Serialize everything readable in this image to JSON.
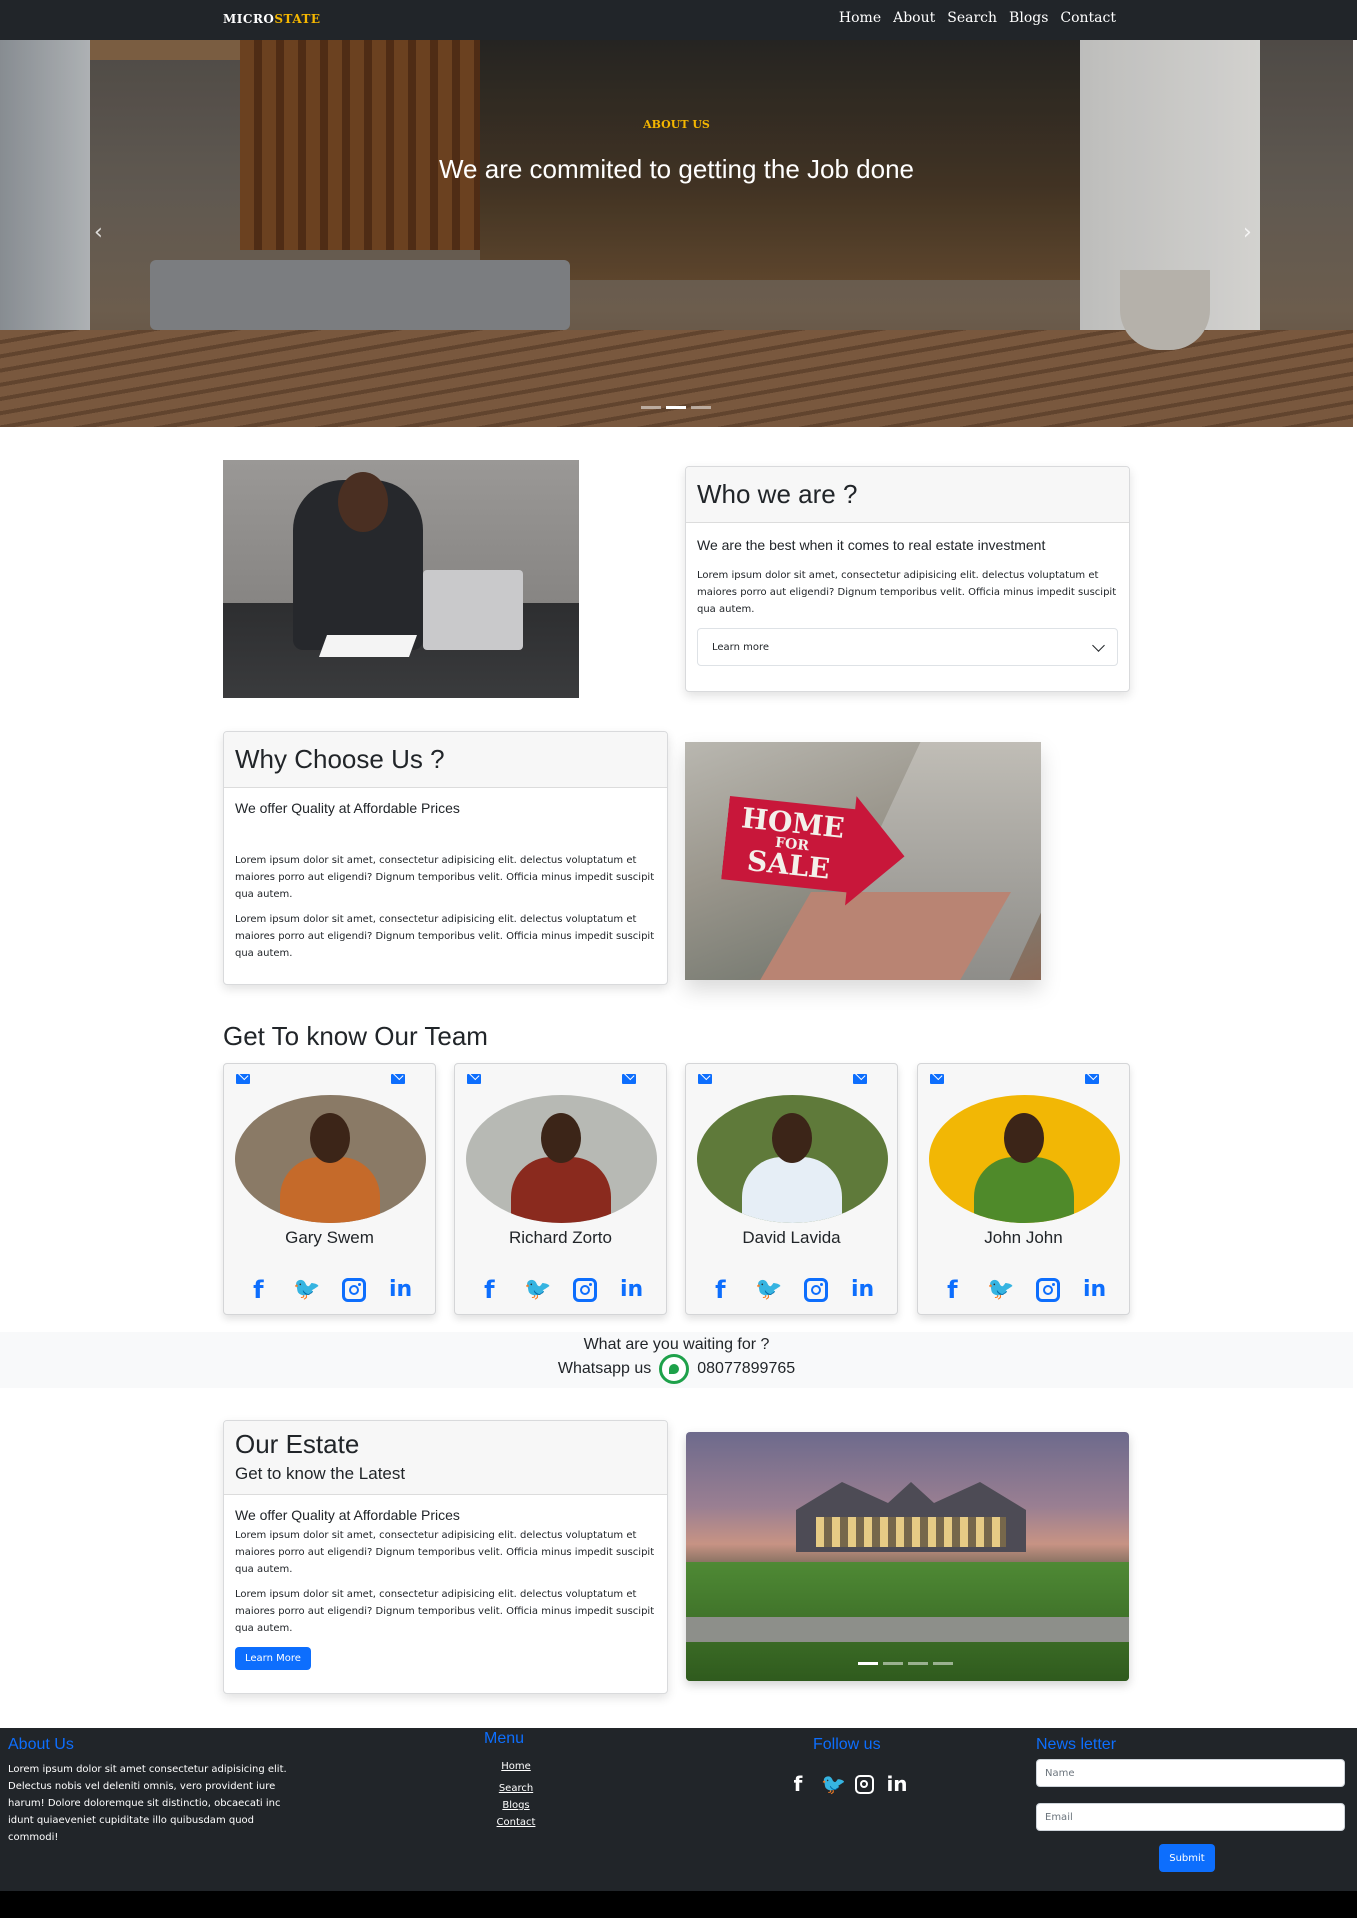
{
  "navbar": {
    "brand_a": "MICRO",
    "brand_b": "STATE",
    "links": [
      "Home",
      "About",
      "Search",
      "Blogs",
      "Contact"
    ]
  },
  "hero": {
    "kicker": "ABOUT US",
    "title": "We are commited to getting the Job done",
    "prev_icon": "chevron-left-icon",
    "next_icon": "chevron-right-icon",
    "prev_glyph": "‹",
    "next_glyph": "›",
    "active_slide": 2,
    "slide_count": 3
  },
  "who": {
    "title": "Who we are ?",
    "lead": "We are the best when it comes to real estate investment",
    "text": "Lorem ipsum dolor sit amet, consectetur adipisicing elit. delectus voluptatum et maiores porro aut eligendi? Dignum temporibus velit. Officia minus impedit suscipit qua autem.",
    "accordion_label": "Learn more"
  },
  "why": {
    "title": "Why Choose Us ?",
    "lead": "We offer Quality at Affordable Prices",
    "text1": "Lorem ipsum dolor sit amet, consectetur adipisicing elit. delectus voluptatum et maiores porro aut eligendi? Dignum temporibus velit. Officia minus impedit suscipit qua autem.",
    "text2": "Lorem ipsum dolor sit amet, consectetur adipisicing elit. delectus voluptatum et maiores porro aut eligendi? Dignum temporibus velit. Officia minus impedit suscipit qua autem.",
    "sign": {
      "l1": "HOME",
      "l2": "FOR",
      "l3": "SALE"
    }
  },
  "team": {
    "heading": "Get To know Our Team",
    "social_glyphs": {
      "facebook": "f",
      "twitter": "🐦",
      "linkedin": "in"
    },
    "members": [
      {
        "name": "Gary Swem",
        "bg": "#8a7a66",
        "outfit": "#c56a2a"
      },
      {
        "name": "Richard Zorto",
        "bg": "#b7b9b4",
        "outfit": "#8a2a1e"
      },
      {
        "name": "David Lavida",
        "bg": "#5f7a3a",
        "outfit": "#e6eef6"
      },
      {
        "name": "John John",
        "bg": "#f2b705",
        "outfit": "#4f8a2a"
      }
    ]
  },
  "whatsapp": {
    "question": "What are you waiting for ?",
    "label": "Whatsapp us",
    "phone": "08077899765",
    "icon": "whatsapp-icon"
  },
  "estate": {
    "title": "Our Estate",
    "subtitle": "Get to know the Latest",
    "lead": "We offer Quality at Affordable Prices",
    "text1": "Lorem ipsum dolor sit amet, consectetur adipisicing elit. delectus voluptatum et maiores porro aut eligendi? Dignum temporibus velit. Officia minus impedit suscipit qua autem.",
    "text2": "Lorem ipsum dolor sit amet, consectetur adipisicing elit. delectus voluptatum et maiores porro aut eligendi? Dignum temporibus velit. Officia minus impedit suscipit qua autem.",
    "button": "Learn More",
    "active_slide": 1,
    "slide_count": 4
  },
  "footer": {
    "about_title": "About Us",
    "about_text": "Lorem ipsum dolor sit amet consectetur adipisicing elit. Delectus nobis vel deleniti omnis, vero provident iure harum! Dolore doloremque sit distinctio, obcaecati inc idunt quiaeveniet cupiditate illo quibusdam quod commodi!",
    "menu_title": "Menu",
    "menu_links": [
      "Home",
      "Search",
      "Blogs",
      "Contact"
    ],
    "follow_title": "Follow us",
    "news_title": "News letter",
    "name_placeholder": "Name",
    "email_placeholder": "Email",
    "submit": "Submit"
  }
}
